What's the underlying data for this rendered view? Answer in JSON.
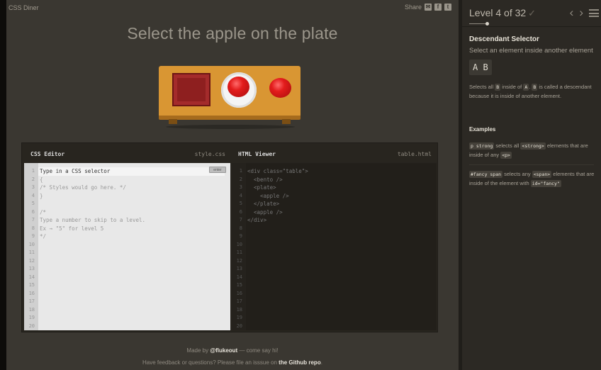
{
  "app": {
    "title": "CSS Diner"
  },
  "share": {
    "label": "Share",
    "icons": [
      "email-icon",
      "facebook-icon",
      "twitter-icon"
    ]
  },
  "instruction": "Select the apple on the plate",
  "board": {
    "items": [
      "table",
      "bento",
      "plate",
      "apple-on-plate",
      "apple"
    ],
    "colors": {
      "table": "#d99633",
      "bento": "#8e1f1f",
      "plate": "#f4f4f4",
      "apple": "#e31c1c"
    }
  },
  "css_editor": {
    "title": "CSS Editor",
    "file": "style.css",
    "input_placeholder": "Type in a CSS selector",
    "enter_label": "enter",
    "line_numbers": [
      "1",
      "2",
      "3",
      "4",
      "5",
      "6",
      "7",
      "8",
      "9",
      "10",
      "11",
      "12",
      "13",
      "14",
      "15",
      "16",
      "17",
      "18",
      "19",
      "20"
    ],
    "lines": [
      "{",
      "/* Styles would go here. */",
      "}",
      "",
      "/*",
      "Type a number to skip to a level.",
      "Ex → \"5\" for level 5",
      "*/"
    ]
  },
  "html_viewer": {
    "title": "HTML Viewer",
    "file": "table.html",
    "line_numbers": [
      "1",
      "2",
      "3",
      "4",
      "5",
      "6",
      "7",
      "8",
      "9",
      "10",
      "11",
      "12",
      "13",
      "14",
      "15",
      "16",
      "17",
      "18",
      "19",
      "20"
    ],
    "lines": [
      "<div class=\"table\">",
      "  <bento />",
      "  <plate>",
      "    <apple />",
      "  </plate>",
      "  <apple />",
      "</div>"
    ]
  },
  "footer": {
    "made_by_prefix": "Made by ",
    "made_by_author": "@flukeout",
    "made_by_suffix": " — come say hi!",
    "feedback_prefix": "Have feedback or questions? Please file an isssue on ",
    "feedback_link": "the Github repo",
    "feedback_suffix": "."
  },
  "sidebar": {
    "level_label": "Level 4 of 32",
    "check": "✓",
    "prev": "‹",
    "next": "›",
    "progress_fraction": 0.125,
    "selector_name": "Descendant Selector",
    "selector_desc": "Select an element inside another element",
    "syntax": "A B",
    "hint": {
      "t1": "Selects all ",
      "c1": "B",
      "t2": " inside of ",
      "c2": "A",
      "t3": ". ",
      "c3": "B",
      "t4": " is called a descendant because it is inside of another element."
    },
    "examples_title": "Examples",
    "example1": {
      "code1": "p  strong",
      "t1": " selects all ",
      "code2": "<strong>",
      "t2": " elements that are inside of any ",
      "code3": "<p>"
    },
    "example2": {
      "code1": "#fancy  span",
      "t1": " selects any ",
      "code2": "<span>",
      "t2": " elements that are inside of the element with ",
      "code3": "id=\"fancy\""
    }
  }
}
